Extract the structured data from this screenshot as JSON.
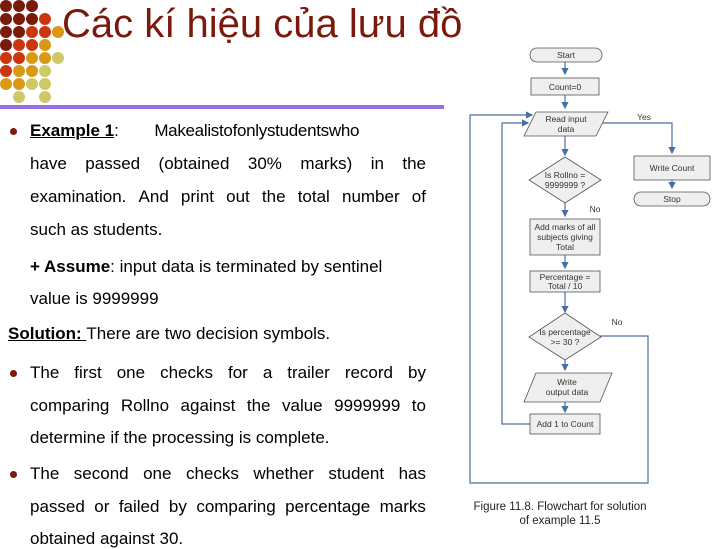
{
  "slide": {
    "title": "Các kí hiệu của lưu đồ",
    "colors": {
      "title": "#7a1a0c",
      "rule": "#9a6ee6",
      "bullet": "#7a1a0c",
      "dot_palette": [
        "#7a1a0c",
        "#c9360f",
        "#d89a14",
        "#cfc866"
      ]
    }
  },
  "body": {
    "example": {
      "label": "Example 1",
      "colon": ":",
      "first_line": "Makealistofonlystudentswho",
      "lines": [
        "have passed (obtained 30% marks) in the",
        "examination. And print out the total number of",
        "such as students."
      ]
    },
    "assume": {
      "prefix": "+ ",
      "label": "Assume",
      "text": ": input data is terminated by sentinel",
      "line2": "value is 9999999"
    },
    "solution": {
      "label": "Solution: ",
      "text": "There are two decision symbols."
    },
    "bullet1": {
      "lines": [
        "The first one checks for a trailer record by",
        "comparing Rollno against the value 9999999 to",
        "determine if the processing is complete."
      ]
    },
    "bullet2": {
      "lines": [
        "The second one checks whether student has",
        "passed or failed by comparing percentage marks",
        "obtained against 30."
      ]
    }
  },
  "flowchart": {
    "start": "Start",
    "init": "Count=0",
    "read": [
      "Read input",
      "data"
    ],
    "decision1": [
      "Is Rollno =",
      "9999999 ?"
    ],
    "yes_label": "Yes",
    "no_label_1": "No",
    "write_count": "Write Count",
    "stop": "Stop",
    "add_marks": [
      "Add marks of all",
      "subjects giving",
      "Total"
    ],
    "percentage": [
      "Percentage =",
      "Total / 10"
    ],
    "decision2": [
      "Is percentage",
      ">= 30 ?"
    ],
    "no_label_2": "No",
    "write_output": [
      "Write",
      "output data"
    ],
    "add_count": "Add 1 to Count",
    "caption": [
      "Figure 11.8. Flowchart for solution",
      "of example 11.5"
    ]
  }
}
